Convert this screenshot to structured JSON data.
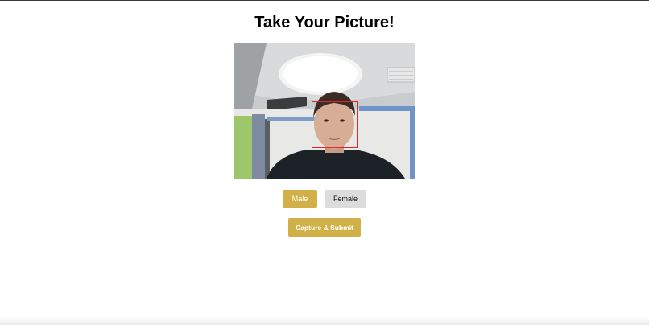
{
  "page": {
    "title": "Take Your Picture!"
  },
  "gender": {
    "male_label": "Male",
    "female_label": "Female",
    "selected": "Male"
  },
  "actions": {
    "submit_label": "Capture & Submit"
  },
  "colors": {
    "accent": "#d2b048",
    "neutral_button": "#dcdcdc",
    "face_box": "#e0262b"
  }
}
